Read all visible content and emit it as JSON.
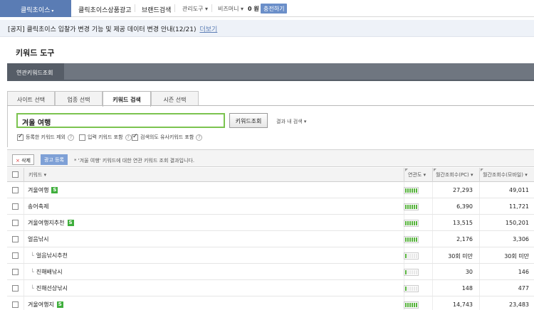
{
  "topnav": {
    "brand": "클릭초이스",
    "items": [
      "클릭초이스상품광고",
      "브랜드검색",
      "관리도구",
      "비즈머니"
    ],
    "balance": "0 원",
    "charge": "충전하기"
  },
  "notice": {
    "text": "[공지] 클릭초이스 입찰가 변경 기능 및 제공 데이터 변경 안내(12/21)",
    "more": "더보기"
  },
  "page_title": "키워드 도구",
  "section_tab": "연관키워드조회",
  "tabs": [
    "사이트 선택",
    "업종 선택",
    "키워드 검색",
    "시즌 선택"
  ],
  "search": {
    "query": "겨울 여행",
    "button": "키워드조회",
    "result_search": "결과 내 검색"
  },
  "options": [
    {
      "label": "등록한 키워드 제외",
      "checked": true
    },
    {
      "label": "입력 키워드 포함",
      "checked": false
    },
    {
      "label": "검색의도 유사키워드 포함",
      "checked": true
    }
  ],
  "actions": {
    "delete": "삭제",
    "register": "광고 등록",
    "message": "* '겨울 여행' 키워드에 대한 연관 키워드 조회 결과입니다."
  },
  "columns": {
    "keyword": "키워드",
    "relevance": "연관도",
    "pc": "월간조회수(PC)",
    "mobile": "월간조회수(모바일)"
  },
  "rows": [
    {
      "keyword": "겨울여행",
      "sub": false,
      "badge": "S",
      "relevance": 6,
      "pc": "27,293",
      "mobile": "49,011"
    },
    {
      "keyword": "송어축제",
      "sub": false,
      "badge": "",
      "relevance": 6,
      "pc": "6,390",
      "mobile": "11,721"
    },
    {
      "keyword": "겨울여행지추천",
      "sub": false,
      "badge": "S",
      "relevance": 6,
      "pc": "13,515",
      "mobile": "150,201"
    },
    {
      "keyword": "얼음낚시",
      "sub": false,
      "badge": "",
      "relevance": 6,
      "pc": "2,176",
      "mobile": "3,306"
    },
    {
      "keyword": "얼음낚시추천",
      "sub": true,
      "badge": "",
      "relevance": 1,
      "pc": "30회 미만",
      "mobile": "30회 미만"
    },
    {
      "keyword": "진해배낚시",
      "sub": true,
      "badge": "",
      "relevance": 1,
      "pc": "30",
      "mobile": "146"
    },
    {
      "keyword": "진해선상낚시",
      "sub": true,
      "badge": "",
      "relevance": 1,
      "pc": "148",
      "mobile": "477"
    },
    {
      "keyword": "겨울여행지",
      "sub": false,
      "badge": "S",
      "relevance": 6,
      "pc": "14,743",
      "mobile": "23,483"
    }
  ]
}
